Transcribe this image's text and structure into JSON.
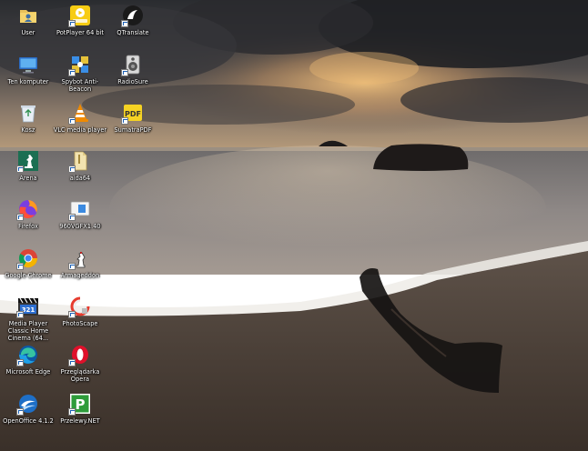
{
  "desktop": {
    "icons": [
      {
        "label": "User",
        "icon": "user-folder-icon"
      },
      {
        "label": "PotPlayer 64 bit",
        "icon": "potplayer-icon"
      },
      {
        "label": "QTranslate",
        "icon": "qtranslate-icon"
      },
      {
        "label": "Ten komputer",
        "icon": "computer-icon"
      },
      {
        "label": "Spybot Anti-Beacon",
        "icon": "spybot-icon"
      },
      {
        "label": "RadioSure",
        "icon": "radiosure-icon"
      },
      {
        "label": "Kosz",
        "icon": "recycle-bin-icon"
      },
      {
        "label": "VLC media player",
        "icon": "vlc-icon"
      },
      {
        "label": "SumatraPDF",
        "icon": "sumatrapdf-icon"
      },
      {
        "label": "Arena",
        "icon": "arena-chess-icon"
      },
      {
        "label": "aida64",
        "icon": "aida64-icon"
      },
      {
        "label": "Firefox",
        "icon": "firefox-icon"
      },
      {
        "label": "960VGFX1.40",
        "icon": "960vgfx-icon"
      },
      {
        "label": "Google Chrome",
        "icon": "chrome-icon"
      },
      {
        "label": "Armageddon",
        "icon": "armageddon-icon"
      },
      {
        "label": "Media Player Classic Home Cinema (64...",
        "icon": "mpc-hc-icon"
      },
      {
        "label": "PhotoScape",
        "icon": "photoscape-icon"
      },
      {
        "label": "Microsoft Edge",
        "icon": "edge-icon"
      },
      {
        "label": "Przeglądarka Opera",
        "icon": "opera-icon"
      },
      {
        "label": "OpenOffice 4.1.2",
        "icon": "openoffice-icon"
      },
      {
        "label": "Przelewy.NET",
        "icon": "przelewy-icon"
      }
    ]
  }
}
